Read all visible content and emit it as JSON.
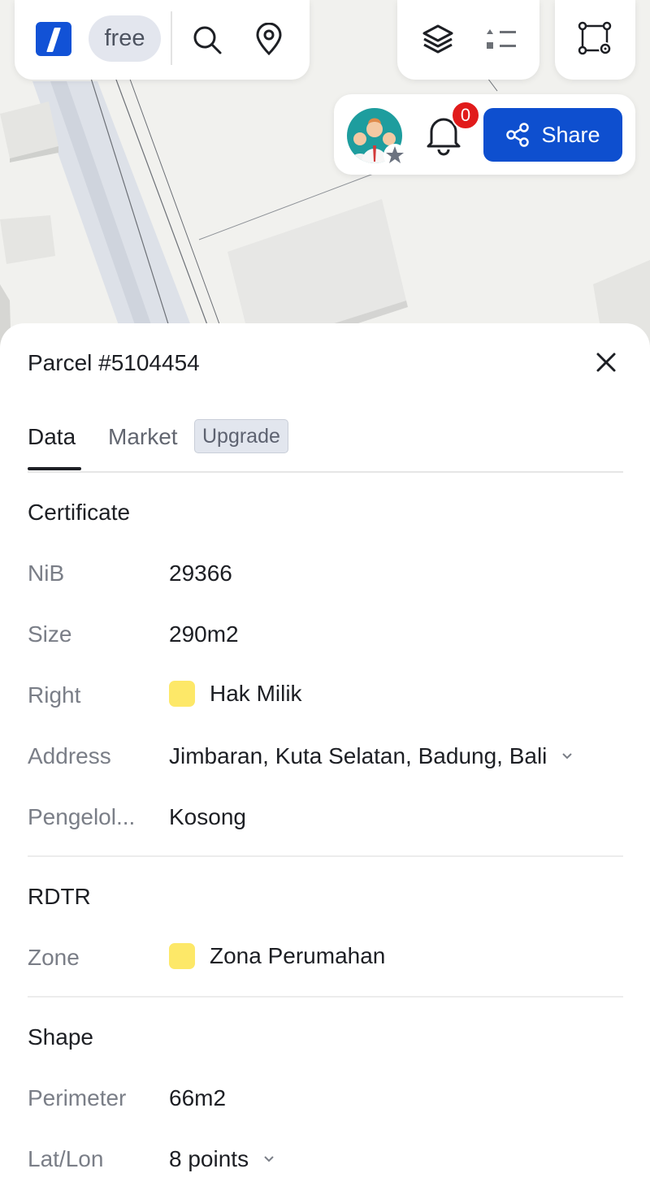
{
  "toolbar": {
    "plan_badge": "free",
    "icons": {
      "logo": "app-logo",
      "search": "search-icon",
      "location": "location-pin-icon",
      "layers": "layers-icon",
      "legend": "legend-list-icon",
      "shape_settings": "shape-settings-icon"
    }
  },
  "user": {
    "notifications_count": "0",
    "share_label": "Share"
  },
  "sheet": {
    "title": "Parcel #5104454",
    "tabs": {
      "data": "Data",
      "market": "Market",
      "upgrade_badge": "Upgrade"
    },
    "certificate": {
      "heading": "Certificate",
      "nib_label": "NiB",
      "nib_value": "29366",
      "size_label": "Size",
      "size_value": "290m2",
      "right_label": "Right",
      "right_value": "Hak Milik",
      "address_label": "Address",
      "address_value": "Jimbaran, Kuta Selatan, Badung, Bali",
      "manager_label": "Pengelol...",
      "manager_value": "Kosong"
    },
    "rdtr": {
      "heading": "RDTR",
      "zone_label": "Zone",
      "zone_value": "Zona Perumahan"
    },
    "shape": {
      "heading": "Shape",
      "perimeter_label": "Perimeter",
      "perimeter_value": "66m2",
      "latlon_label": "Lat/Lon",
      "latlon_value": "8 points"
    }
  },
  "colors": {
    "accent": "#0e4fcf",
    "notification": "#e11b1b",
    "swatch_yellow": "#fde868"
  }
}
